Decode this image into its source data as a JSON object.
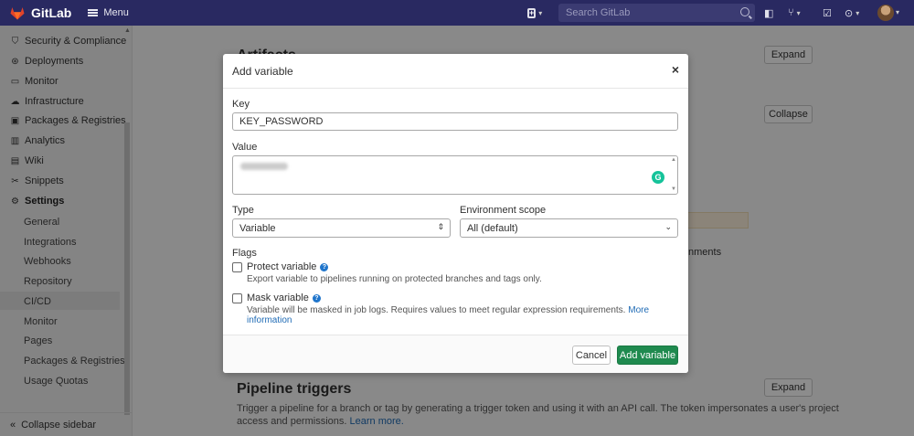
{
  "navbar": {
    "brand": "GitLab",
    "menu_label": "Menu",
    "search_placeholder": "Search GitLab"
  },
  "sidebar": {
    "items": [
      {
        "label": "Security & Compliance",
        "icon": "shield-icon"
      },
      {
        "label": "Deployments",
        "icon": "rocket-icon"
      },
      {
        "label": "Monitor",
        "icon": "monitor-icon"
      },
      {
        "label": "Infrastructure",
        "icon": "cloud-icon"
      },
      {
        "label": "Packages & Registries",
        "icon": "package-icon"
      },
      {
        "label": "Analytics",
        "icon": "chart-icon"
      },
      {
        "label": "Wiki",
        "icon": "book-icon"
      },
      {
        "label": "Snippets",
        "icon": "scissors-icon"
      },
      {
        "label": "Settings",
        "icon": "gear-icon"
      }
    ],
    "settings_subitems": [
      "General",
      "Integrations",
      "Webhooks",
      "Repository",
      "CI/CD",
      "Monitor",
      "Pages",
      "Packages & Registries",
      "Usage Quotas"
    ],
    "active_subitem": "CI/CD",
    "collapse_label": "Collapse sidebar"
  },
  "background": {
    "artifacts_heading": "Artifacts",
    "expand_label": "Expand",
    "collapse_label": "Collapse",
    "environments_fragment": "nments",
    "pipeline_triggers_heading": "Pipeline triggers",
    "pipeline_triggers_desc": "Trigger a pipeline for a branch or tag by generating a trigger token and using it with an API call. The token impersonates a user's project",
    "pipeline_triggers_desc2": "access and permissions.",
    "learn_more": "Learn more."
  },
  "modal": {
    "title": "Add variable",
    "close_glyph": "×",
    "key_label": "Key",
    "key_value": "KEY_PASSWORD",
    "value_label": "Value",
    "type_label": "Type",
    "type_value": "Variable",
    "scope_label": "Environment scope",
    "scope_value": "All (default)",
    "flags_label": "Flags",
    "protect_label": "Protect variable",
    "protect_help": "Export variable to pipelines running on protected branches and tags only.",
    "mask_label": "Mask variable",
    "mask_help": "Variable will be masked in job logs. Requires values to meet regular expression requirements.",
    "more_info": "More information",
    "cancel_label": "Cancel",
    "add_label": "Add variable"
  },
  "colors": {
    "navbar": "#292961",
    "primary_button": "#1f8a4f",
    "link": "#1f6bb5",
    "grammarly": "#15c39a"
  }
}
